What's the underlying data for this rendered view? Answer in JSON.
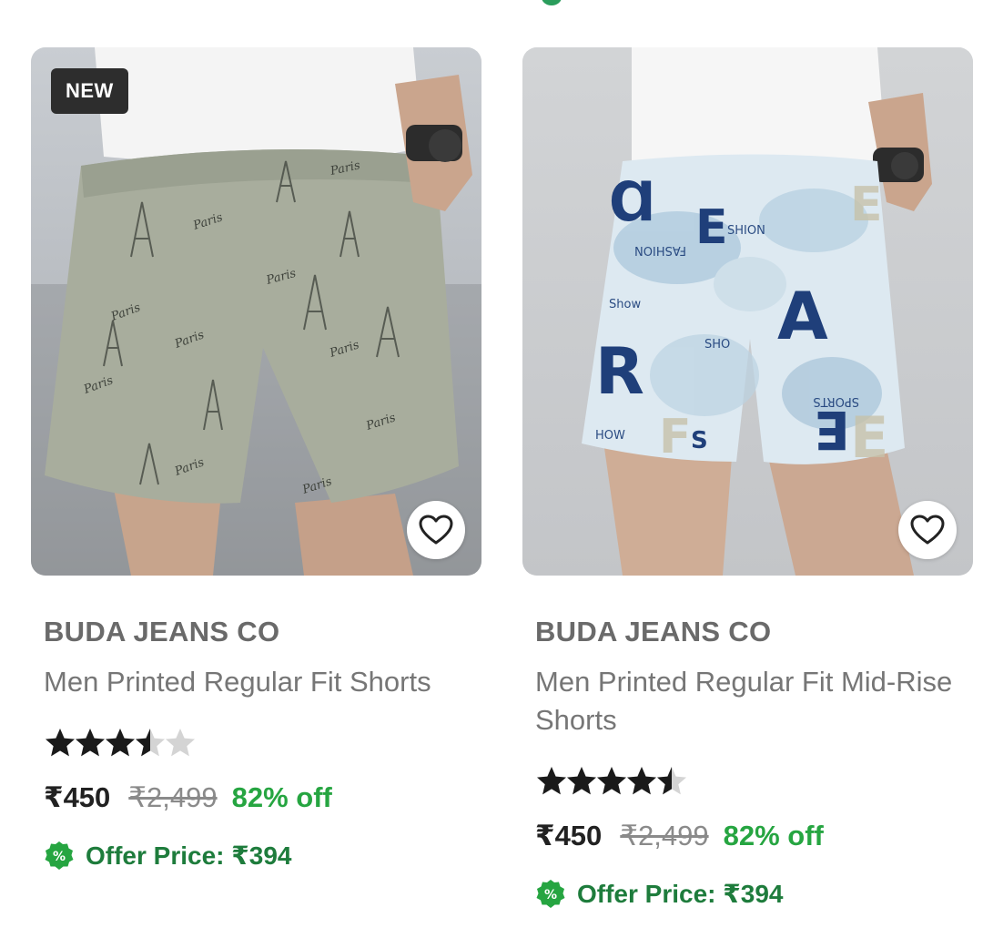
{
  "colors": {
    "discount": "#26a541",
    "offer": "#1e7c3c",
    "badge_bg": "#2d2d2d",
    "star_filled": "#1a1a1a",
    "star_empty": "#d4d4d4"
  },
  "products": [
    {
      "badge": "NEW",
      "image_icon": "product-image-grey-printed-shorts",
      "wishlist_icon": "heart-outline-icon",
      "brand": "BUDA JEANS CO",
      "title": "Men Printed Regular Fit Shorts",
      "rating_stars": 3.5,
      "rating_max": 5,
      "price": "₹450",
      "mrp": "₹2,499",
      "discount": "82% off",
      "offer_icon": "percent-badge-icon",
      "offer_label": "Offer Price: ",
      "offer_price": "₹394"
    },
    {
      "badge": "",
      "image_icon": "product-image-blue-tie-dye-shorts",
      "wishlist_icon": "heart-outline-icon",
      "brand": "BUDA JEANS CO",
      "title": "Men Printed Regular Fit Mid-Rise Shorts",
      "rating_stars": 4.5,
      "rating_max": 5,
      "price": "₹450",
      "mrp": "₹2,499",
      "discount": "82% off",
      "offer_icon": "percent-badge-icon",
      "offer_label": "Offer Price: ",
      "offer_price": "₹394"
    }
  ]
}
